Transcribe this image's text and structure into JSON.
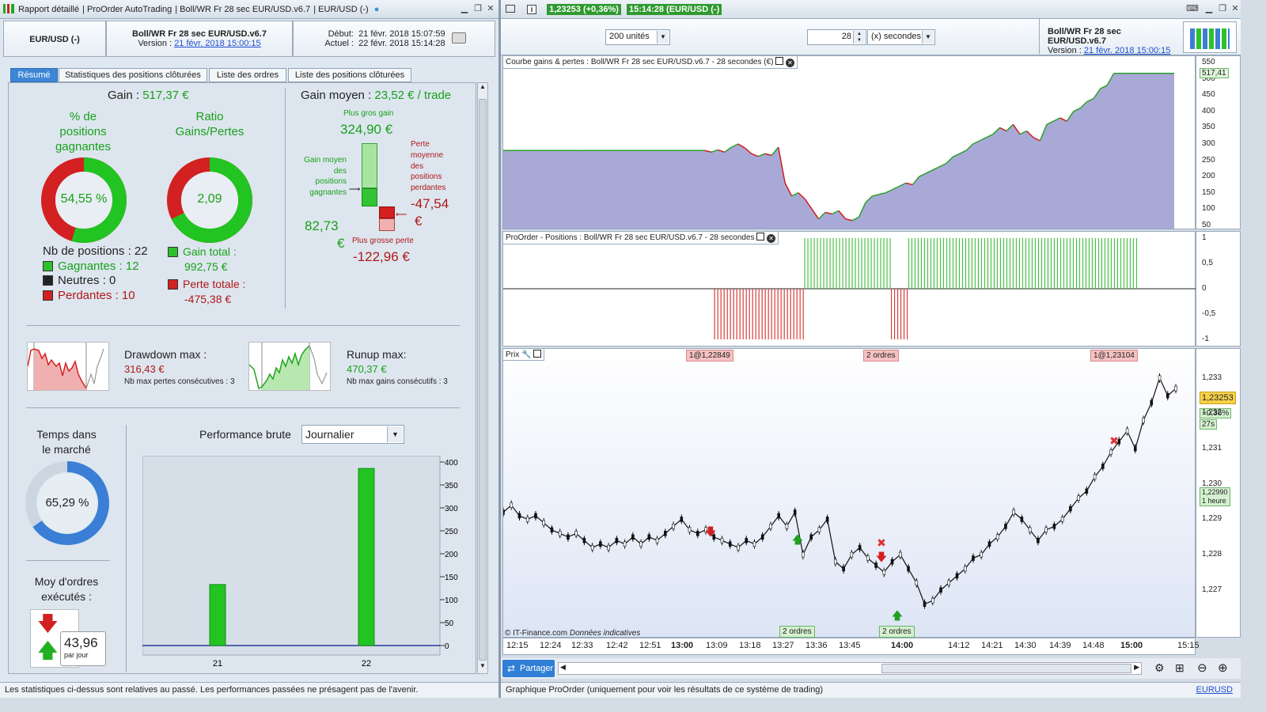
{
  "left_window": {
    "title_items": [
      "Rapport détaillé",
      "ProOrder AutoTrading",
      "Boll/WR Fr 28 sec EUR/USD.v6.7",
      "EUR/USD (-)"
    ],
    "instrument": "EUR/USD (-)",
    "strategy_name": "Boll/WR Fr 28 sec EUR/USD.v6.7",
    "version_label": "Version :",
    "version_value": "21 févr. 2018 15:00:15",
    "start_label": "Début:",
    "start_value": "21 févr. 2018 15:07:59",
    "current_label": "Actuel :",
    "current_value": "22 févr. 2018 15:14:28",
    "tabs": [
      "Résumé",
      "Statistiques des positions clôturées",
      "Liste des ordres",
      "Liste des positions clôturées"
    ],
    "gain_label": "Gain :",
    "gain_value": "517,37 €",
    "pct_win_title": [
      "% de",
      "positions",
      "gagnantes"
    ],
    "pct_win_value": "54,55 %",
    "pct_win_fraction": 0.5455,
    "ratio_title": [
      "Ratio",
      "Gains/Pertes"
    ],
    "ratio_value": "2,09",
    "nb_positions": "Nb de positions : 22",
    "gagnantes": "Gagnantes : 12",
    "neutres": "Neutres : 0",
    "perdantes": "Perdantes : 10",
    "gain_total_label": "Gain total :",
    "gain_total_value": "992,75 €",
    "perte_totale_label": "Perte totale :",
    "perte_totale_value": "-475,38 €",
    "gain_moyen_label": "Gain moyen :",
    "gain_moyen_value": "23,52 € / trade",
    "plus_gros_gain_label": "Plus gros gain",
    "plus_gros_gain_value": "324,90 €",
    "gain_moyen_gagnantes_label": [
      "Gain moyen",
      "des",
      "positions",
      "gagnantes"
    ],
    "gain_moyen_gagnantes_value": "82,73",
    "euro": "€",
    "perte_moyenne_label": [
      "Perte",
      "moyenne",
      "des",
      "positions",
      "perdantes"
    ],
    "perte_moyenne_value": "-47,54",
    "plus_grosse_perte_label": "Plus grosse perte",
    "plus_grosse_perte_value": "-122,96 €",
    "drawdown_label": "Drawdown max :",
    "drawdown_value": "316,43 €",
    "drawdown_sub": "Nb max pertes consécutives : 3",
    "runup_label": "Runup max:",
    "runup_value": "470,37 €",
    "runup_sub": "Nb max gains consécutifs : 3",
    "temps_label": [
      "Temps dans",
      "le marché"
    ],
    "temps_value": "65,29 %",
    "temps_fraction": 0.6529,
    "moy_ordres_label": [
      "Moy d'ordres",
      "exécutés :"
    ],
    "moy_ordres_value": "43,96",
    "moy_ordres_unit": "par jour",
    "perf_label": "Performance brute",
    "perf_period": "Journalier",
    "footer": "Les statistiques ci-dessus sont relatives au passé. Les performances passées ne présagent pas de l'avenir.",
    "colors": {
      "green": "#22c422",
      "red": "#d32020",
      "blue": "#3a7fd5"
    }
  },
  "chart_data": [
    {
      "type": "bar",
      "title": "Performance brute",
      "categories": [
        "21",
        "22"
      ],
      "values": [
        133,
        386
      ],
      "ylim": [
        0,
        400
      ],
      "yticks": [
        "400",
        "350",
        "300",
        "250",
        "200",
        "150",
        "100",
        "50",
        "0"
      ]
    },
    {
      "type": "area",
      "title": "Courbe gains & pertes : Boll/WR Fr 28 sec EUR/USD.v6.7 - 28 secondes (€)",
      "yticks": [
        "550",
        "500",
        "450",
        "400",
        "350",
        "300",
        "250",
        "200",
        "150",
        "100",
        "50"
      ],
      "ylim": [
        40,
        560
      ],
      "last_value": "517,41",
      "values": [
        280,
        280,
        280,
        280,
        280,
        280,
        280,
        280,
        280,
        280,
        280,
        280,
        280,
        280,
        280,
        280,
        280,
        280,
        280,
        280,
        280,
        280,
        280,
        280,
        280,
        280,
        280,
        280,
        280,
        280,
        280,
        275,
        282,
        275,
        290,
        300,
        288,
        270,
        262,
        270,
        265,
        290,
        180,
        140,
        150,
        130,
        100,
        70,
        90,
        85,
        95,
        70,
        65,
        75,
        120,
        140,
        145,
        150,
        160,
        170,
        180,
        175,
        200,
        210,
        220,
        230,
        240,
        260,
        270,
        280,
        300,
        310,
        320,
        330,
        350,
        340,
        360,
        330,
        340,
        320,
        310,
        360,
        370,
        380,
        370,
        400,
        410,
        430,
        440,
        470,
        480,
        517,
        517,
        517,
        517,
        517,
        517,
        517,
        517,
        517,
        517
      ]
    },
    {
      "type": "bar",
      "title": "ProOrder - Positions : Boll/WR Fr 28 sec EUR/USD.v6.7 - 28 secondes",
      "yticks": [
        "1",
        "0,5",
        "0",
        "-0,5",
        "-1"
      ],
      "ylim": [
        -1,
        1
      ],
      "segments": [
        {
          "from": 0.305,
          "to": 0.435,
          "value": -1
        },
        {
          "from": 0.435,
          "to": 0.56,
          "value": 1
        },
        {
          "from": 0.56,
          "to": 0.585,
          "value": -1
        },
        {
          "from": 0.585,
          "to": 0.915,
          "value": 1
        }
      ]
    },
    {
      "type": "line",
      "title": "Prix",
      "x_ticks": [
        "12:15",
        "12:24",
        "12:33",
        "12:42",
        "12:51",
        "13:00",
        "13:09",
        "13:18",
        "13:27",
        "13:36",
        "13:45",
        "14:00",
        "14:12",
        "14:21",
        "14:30",
        "14:39",
        "14:48",
        "15:00",
        "15:15"
      ],
      "yticks": [
        "1,233",
        "1,232",
        "1,231",
        "1,230",
        "1,229",
        "1,228",
        "1,227"
      ],
      "ylim": [
        1.2263,
        1.2336
      ],
      "last_price": "1,23253",
      "last_change": "+0,36%",
      "countdown": "27s",
      "ref_price": "1,22990",
      "ref_label": "1 heure",
      "values": [
        1.2292,
        1.2294,
        1.2291,
        1.229,
        1.2291,
        1.2289,
        1.2287,
        1.2286,
        1.2285,
        1.2286,
        1.2284,
        1.2282,
        1.2283,
        1.2282,
        1.2284,
        1.2283,
        1.2285,
        1.2283,
        1.2285,
        1.2284,
        1.2286,
        1.2288,
        1.229,
        1.2287,
        1.2286,
        1.2287,
        1.2285,
        1.2284,
        1.2283,
        1.2282,
        1.2284,
        1.2283,
        1.2285,
        1.2288,
        1.2291,
        1.2288,
        1.2292,
        1.228,
        1.2285,
        1.2287,
        1.229,
        1.2278,
        1.2276,
        1.228,
        1.2282,
        1.2279,
        1.2277,
        1.2275,
        1.2278,
        1.228,
        1.2276,
        1.2272,
        1.2266,
        1.2267,
        1.227,
        1.2272,
        1.2274,
        1.2276,
        1.2279,
        1.228,
        1.2283,
        1.2285,
        1.2288,
        1.2292,
        1.229,
        1.2287,
        1.2284,
        1.2287,
        1.2288,
        1.229,
        1.2293,
        1.2296,
        1.2298,
        1.2302,
        1.2305,
        1.2309,
        1.2312,
        1.2315,
        1.231,
        1.2318,
        1.2323,
        1.233,
        1.2325,
        1.2327
      ],
      "markers": [
        "1@1,22849",
        "2 ordres",
        "1@1,23104",
        "2 ordres",
        "2 ordres"
      ]
    }
  ],
  "right_window": {
    "price_badge": "1,23253 (+0,36%)",
    "title_rest": "15:14:28 (EUR/USD (-)",
    "units_value": "200 unités",
    "period_value": "28",
    "period_unit": "(x) secondes",
    "strategy_name": "Boll/WR Fr 28 sec EUR/USD.v6.7",
    "version_label": "Version :",
    "version_value": "21 févr. 2018 15:00:15",
    "watermark": "© IT-Finance.com",
    "watermark_note": "Données indicatives",
    "share_label": "Partager",
    "footer": "Graphique ProOrder (uniquement pour voir les résultats de ce système de trading)",
    "symbol": "EURUSD"
  }
}
